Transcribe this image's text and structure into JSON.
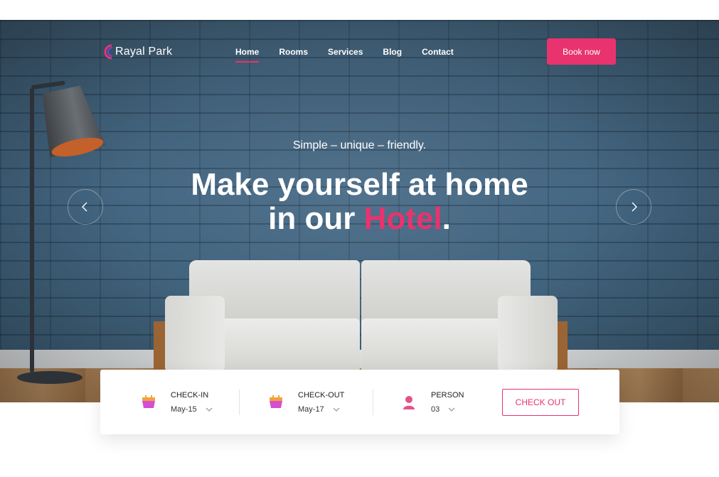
{
  "brand": {
    "name": "Rayal Park"
  },
  "nav": {
    "items": [
      {
        "label": "Home",
        "active": true
      },
      {
        "label": "Rooms",
        "active": false
      },
      {
        "label": "Services",
        "active": false
      },
      {
        "label": "Blog",
        "active": false
      },
      {
        "label": "Contact",
        "active": false
      }
    ],
    "cta_label": "Book now"
  },
  "hero": {
    "tagline": "Simple – unique – friendly.",
    "headline_line1": "Make yourself at home",
    "headline_line2_prefix": "in our ",
    "headline_accent": "Hotel",
    "headline_suffix": "."
  },
  "booking": {
    "checkin": {
      "label": "CHECK-IN",
      "value": "May-15",
      "icon": "calendar-icon"
    },
    "checkout": {
      "label": "CHECK-OUT",
      "value": "May-17",
      "icon": "calendar-icon"
    },
    "person": {
      "label": "PERSON",
      "value": "03",
      "icon": "user-icon"
    },
    "button_label": "CHECK OUT"
  },
  "colors": {
    "accent": "#e8336e",
    "calendar_top": "#f2a23a",
    "calendar_body": "#d64fd0"
  }
}
